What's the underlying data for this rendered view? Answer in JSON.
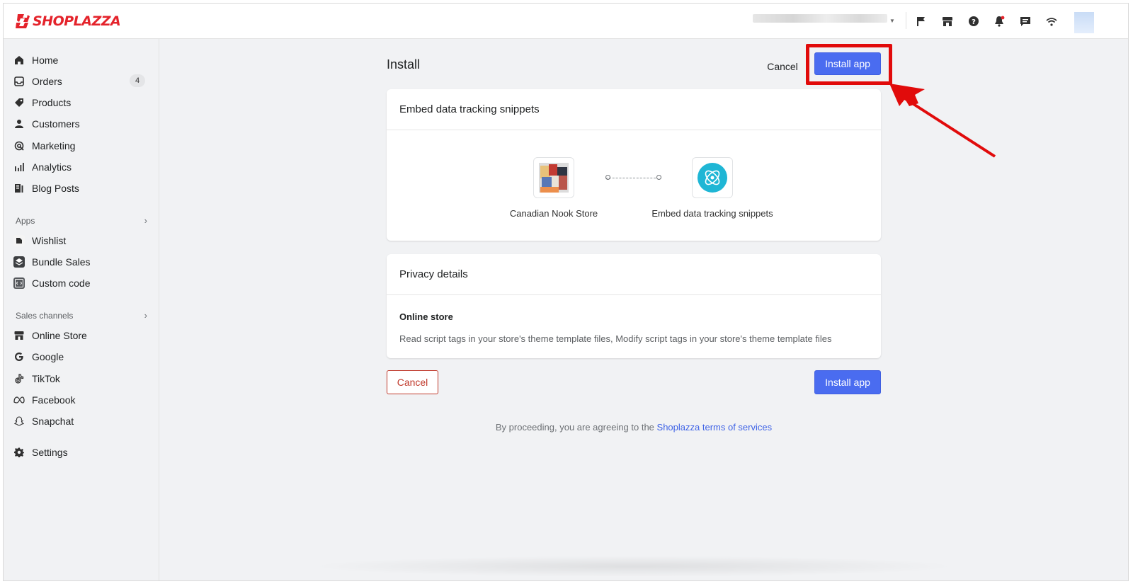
{
  "brand": {
    "name": "SHOPLAZZA"
  },
  "topbar": {
    "icons": [
      "flag-icon",
      "store-icon",
      "help-icon",
      "notification-bell-icon",
      "message-icon",
      "wifi-icon"
    ]
  },
  "sidebar": {
    "items": [
      {
        "label": "Home",
        "icon": "home-icon"
      },
      {
        "label": "Orders",
        "icon": "inbox-icon",
        "badge": "4"
      },
      {
        "label": "Products",
        "icon": "tag-icon"
      },
      {
        "label": "Customers",
        "icon": "person-icon"
      },
      {
        "label": "Marketing",
        "icon": "target-icon"
      },
      {
        "label": "Analytics",
        "icon": "bar-chart-icon"
      },
      {
        "label": "Blog Posts",
        "icon": "blog-icon"
      }
    ],
    "apps_label": "Apps",
    "apps": [
      {
        "label": "Wishlist",
        "icon": "wishlist-app-icon"
      },
      {
        "label": "Bundle Sales",
        "icon": "bundle-app-icon"
      },
      {
        "label": "Custom code",
        "icon": "code-app-icon"
      }
    ],
    "channels_label": "Sales channels",
    "channels": [
      {
        "label": "Online Store",
        "icon": "store-icon"
      },
      {
        "label": "Google",
        "icon": "google-icon"
      },
      {
        "label": "TikTok",
        "icon": "tiktok-icon"
      },
      {
        "label": "Facebook",
        "icon": "meta-icon"
      },
      {
        "label": "Snapchat",
        "icon": "snapchat-icon"
      }
    ],
    "settings_label": "Settings"
  },
  "page": {
    "title": "Install",
    "cancel_label": "Cancel",
    "install_label": "Install app"
  },
  "embed_card": {
    "title": "Embed data tracking snippets",
    "store_name": "Canadian Nook Store",
    "app_name": "Embed data tracking snippets"
  },
  "privacy_card": {
    "title": "Privacy details",
    "section_title": "Online store",
    "section_text": "Read script tags in your store's theme template files, Modify script tags in your store's theme template files"
  },
  "footer": {
    "cancel_label": "Cancel",
    "install_label": "Install app",
    "terms_prefix": "By proceeding, you are agreeing to the ",
    "terms_link": "Shoplazza terms of services"
  },
  "colors": {
    "accent": "#4a6cf0",
    "brand_red": "#e4232b",
    "highlight_red": "#e10b0b",
    "app_icon_teal": "#1fb6d5"
  }
}
